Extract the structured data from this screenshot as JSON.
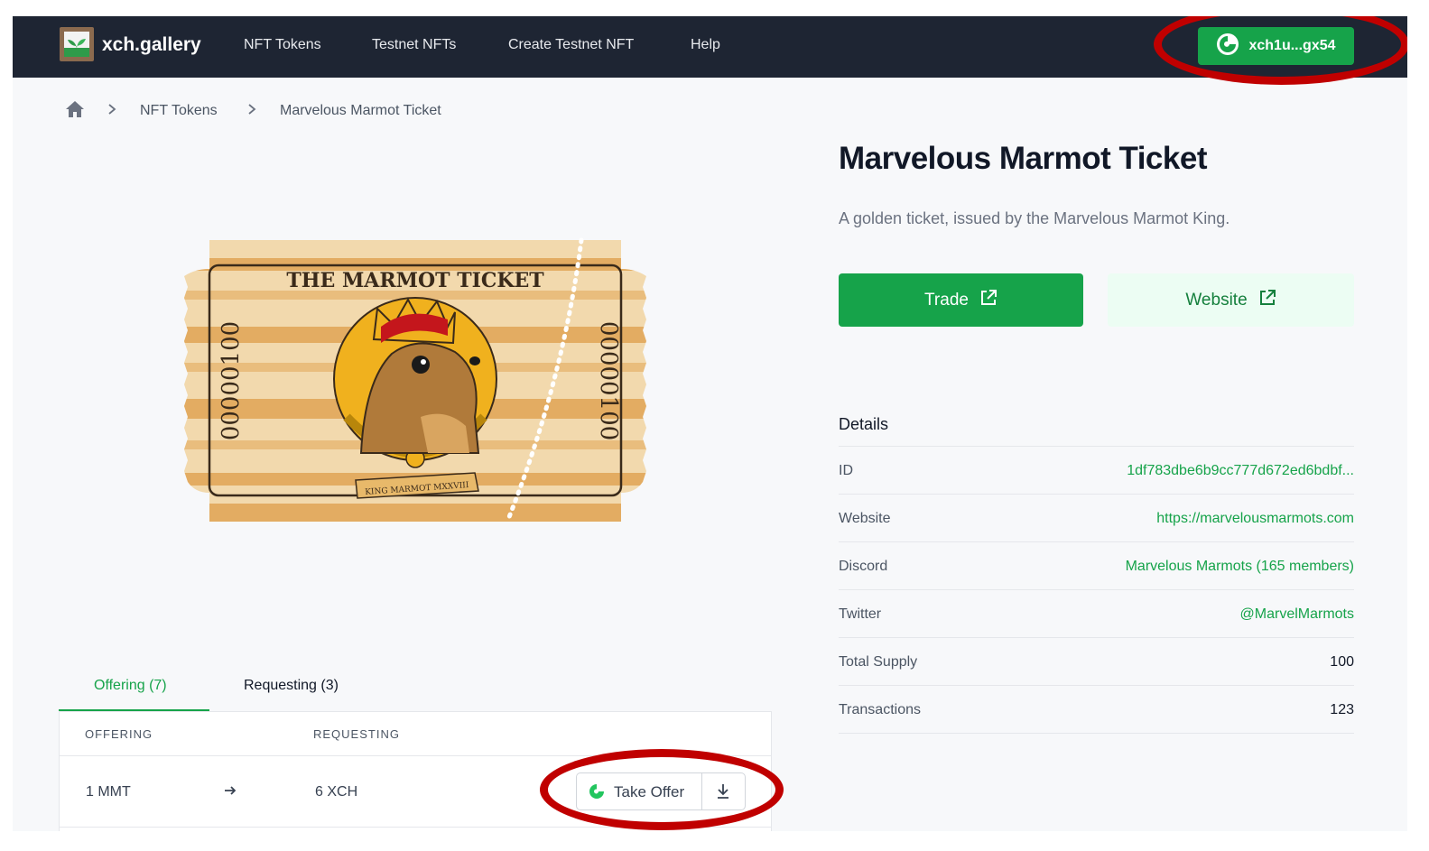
{
  "nav": {
    "brand": "xch.gallery",
    "links": [
      "NFT Tokens",
      "Testnet NFTs",
      "Create Testnet NFT",
      "Help"
    ],
    "wallet": "xch1u...gx54"
  },
  "breadcrumb": {
    "items": [
      "NFT Tokens",
      "Marvelous Marmot Ticket"
    ]
  },
  "token": {
    "title": "Marvelous Marmot Ticket",
    "description": "A golden ticket, issued by the Marvelous Marmot King.",
    "trade_label": "Trade",
    "website_label": "Website"
  },
  "ticket": {
    "heading": "THE MARMOT TICKET",
    "serial": "00000100",
    "ribbon": "KING MARMOT MXXVIII"
  },
  "details": {
    "heading": "Details",
    "rows": [
      {
        "key": "ID",
        "value": "1df783dbe6b9cc777d672ed6bdbf..."
      },
      {
        "key": "Website",
        "value": "https://marvelousmarmots.com"
      },
      {
        "key": "Discord",
        "value": "Marvelous Marmots (165 members)"
      },
      {
        "key": "Twitter",
        "value": "@MarvelMarmots"
      },
      {
        "key": "Total Supply",
        "value": "100"
      },
      {
        "key": "Transactions",
        "value": "123"
      }
    ]
  },
  "offers": {
    "tabs": [
      "Offering (7)",
      "Requesting (3)"
    ],
    "columns": [
      "OFFERING",
      "REQUESTING"
    ],
    "rows": [
      {
        "offering": "1 MMT",
        "requesting": "6 XCH",
        "action": "Take Offer"
      }
    ]
  },
  "colors": {
    "nav_bg": "#1e2533",
    "accent": "#16a34a",
    "annotation_ring": "#c00000"
  },
  "icons": [
    "home-icon",
    "chevron-right-icon",
    "external-link-icon",
    "wallet-logo-icon",
    "arrow-right-icon",
    "download-icon"
  ]
}
